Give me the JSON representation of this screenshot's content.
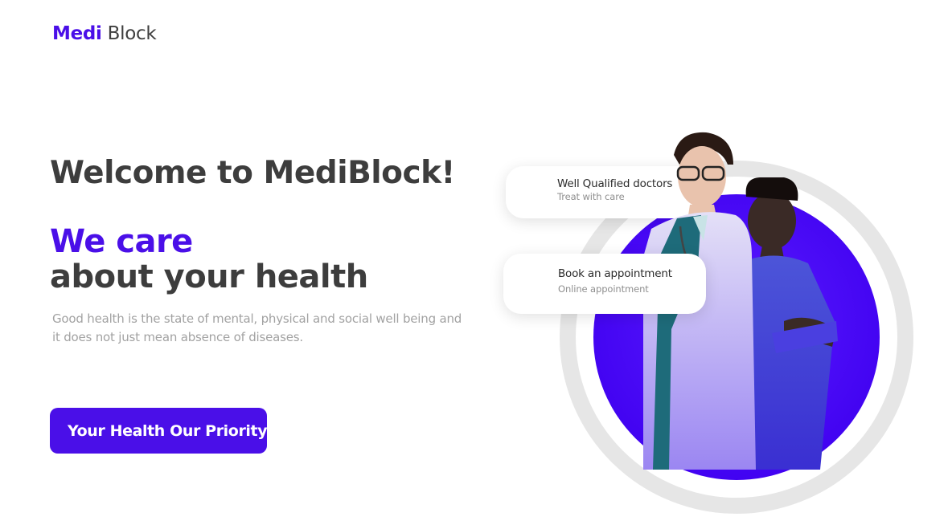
{
  "header": {
    "logo_brand": "Medi",
    "logo_rest": " Block"
  },
  "hero": {
    "welcome": "Welcome to MediBlock!",
    "tagline_accent": "We care",
    "tagline_rest": "about your health",
    "description": "Good health is the state of mental, physical and social well being and it does not just mean absence of diseases.",
    "cta_label": "Your Health Our Priority"
  },
  "cards": [
    {
      "title": "Well Qualified doctors",
      "subtitle": "Treat with care"
    },
    {
      "title": "Book an appointment",
      "subtitle": "Online appointment"
    }
  ],
  "colors": {
    "accent": "#4a0fe8",
    "text_dark": "#3d3d3d",
    "text_muted": "#a2a2a2",
    "ring": "#e6e6e6"
  }
}
